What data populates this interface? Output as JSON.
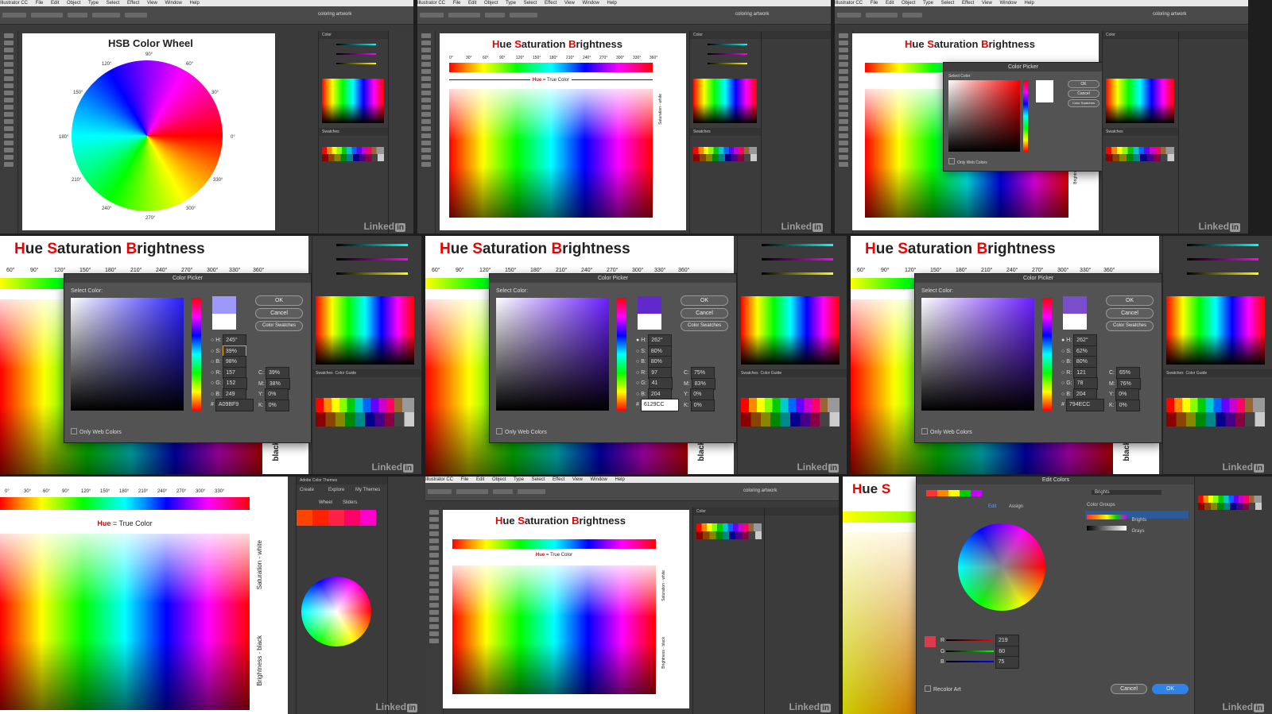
{
  "menubar": {
    "app": "Illustrator CC",
    "items": [
      "File",
      "Edit",
      "Object",
      "Type",
      "Select",
      "Effect",
      "View",
      "Window",
      "Help"
    ]
  },
  "workspace_label": "coloring artwork",
  "watermark": {
    "text": "Linked",
    "badge": "in"
  },
  "tile1": {
    "title": "HSB Color Wheel",
    "degree_labels": [
      "0°",
      "30°",
      "60°",
      "90°",
      "120°",
      "150°",
      "180°",
      "210°",
      "240°",
      "270°",
      "300°",
      "330°"
    ]
  },
  "hsb": {
    "title_h": "H",
    "title_ue": "ue ",
    "title_s": "S",
    "title_at": "aturation ",
    "title_b": "B",
    "title_right": "rightness",
    "degrees": [
      "0°",
      "30°",
      "60°",
      "90°",
      "120°",
      "150°",
      "180°",
      "210°",
      "240°",
      "270°",
      "300°",
      "330°",
      "360°"
    ],
    "degrees_zoom": [
      "60°",
      "90°",
      "120°",
      "150°",
      "180°",
      "210°",
      "240°",
      "270°",
      "300°",
      "330°",
      "360°"
    ],
    "hue_true_color_hue": "Hue",
    "hue_true_color_rest": " = True Color",
    "saturation_label": "Saturation - white",
    "brightness_label": "Brightness - black",
    "black_label": "black"
  },
  "color_picker": {
    "title": "Color Picker",
    "select_color": "Select Color:",
    "ok": "OK",
    "cancel": "Cancel",
    "swatches": "Color Swatches",
    "only_web": "Only Web Colors",
    "dialogs": [
      {
        "H": "245°",
        "S": "39%",
        "B": "98%",
        "R": "157",
        "G": "152",
        "Bv": "249",
        "C": "39%",
        "M": "38%",
        "Y": "0%",
        "K": "0%",
        "hex": "A09BF9",
        "color": "#9d98f9"
      },
      {
        "H": "262°",
        "S": "80%",
        "B": "80%",
        "R": "97",
        "G": "41",
        "Bv": "204",
        "C": "75%",
        "M": "83%",
        "Y": "0%",
        "K": "0%",
        "hex": "6129CC",
        "color": "#6129cc"
      },
      {
        "H": "262°",
        "S": "62%",
        "B": "80%",
        "R": "121",
        "G": "78",
        "Bv": "204",
        "C": "65%",
        "M": "76%",
        "Y": "0%",
        "K": "0%",
        "hex": "794ECC",
        "color": "#794ecc"
      }
    ]
  },
  "labels": {
    "H": "H:",
    "S": "S:",
    "B": "B:",
    "R": "R:",
    "G": "G:",
    "Bl": "B:",
    "C": "C:",
    "M": "M:",
    "Y": "Y:",
    "K": "K:",
    "hash": "#"
  },
  "panels": {
    "swatches_tab": "Swatches",
    "guide_tab": "Color Guide",
    "color_tab": "Color",
    "adobe_themes": "Adobe Color Themes",
    "create": "Create",
    "explore": "Explore",
    "my_themes": "My Themes",
    "wheel": "Wheel",
    "sliders": "Sliders"
  },
  "edit_colors": {
    "title": "Edit Colors",
    "edit_tab": "Edit",
    "assign_tab": "Assign",
    "group_name": "Brights",
    "color_groups": "Color Groups",
    "groups": [
      "Brights",
      "Grays"
    ],
    "R": "219",
    "G": "60",
    "B": "75",
    "recolor_art": "Recolor Art",
    "cancel": "Cancel",
    "ok": "OK"
  },
  "colors": {
    "accent_red": "#e00000",
    "ok_blue": "#2f82e8"
  }
}
